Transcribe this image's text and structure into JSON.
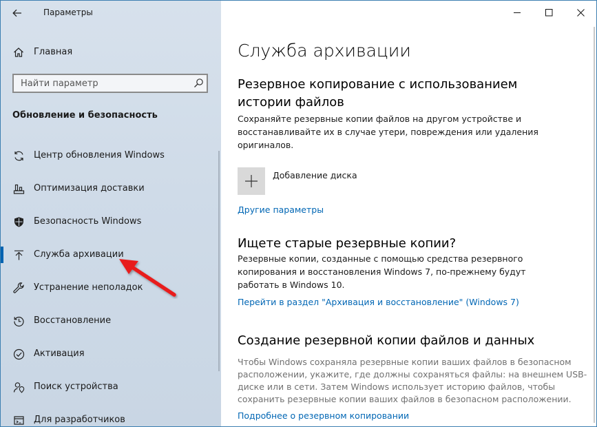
{
  "window": {
    "title": "Параметры",
    "controls": [
      "minimize-icon",
      "maximize-icon",
      "close-icon"
    ]
  },
  "sidebar": {
    "back_icon": "arrow-left-icon",
    "home": {
      "label": "Главная",
      "icon": "home-icon"
    },
    "search": {
      "placeholder": "Найти параметр",
      "value": "",
      "icon": "search-icon"
    },
    "section_title": "Обновление и безопасность",
    "selected_index": 3,
    "items": [
      {
        "label": "Центр обновления Windows",
        "icon": "sync-icon"
      },
      {
        "label": "Оптимизация доставки",
        "icon": "delivery-optimization-icon"
      },
      {
        "label": "Безопасность Windows",
        "icon": "shield-icon"
      },
      {
        "label": "Служба архивации",
        "icon": "upload-arrow-icon"
      },
      {
        "label": "Устранение неполадок",
        "icon": "wrench-icon"
      },
      {
        "label": "Восстановление",
        "icon": "history-icon"
      },
      {
        "label": "Активация",
        "icon": "check-circle-icon"
      },
      {
        "label": "Поиск устройства",
        "icon": "person-location-icon"
      },
      {
        "label": "Для разработчиков",
        "icon": "developer-icon"
      }
    ]
  },
  "main": {
    "title": "Служба архивации",
    "file_history": {
      "heading_line1": "Резервное копирование с использованием",
      "heading_line2": "истории файлов",
      "desc_line1": "Сохраняйте резервные копии файлов на другом устройстве и",
      "desc_line2": "восстанавливайте их в случае утери, повреждения или удаления",
      "desc_line3": "оригиналов.",
      "add_drive_label": "Добавление диска",
      "add_drive_icon": "plus-icon",
      "more_options": "Другие параметры"
    },
    "old_backup": {
      "heading": "Ищете старые резервные копии?",
      "desc_line1": "Резервные копии, созданные с помощью средства резервного",
      "desc_line2": "копирования и восстановления Windows 7, по-прежнему будут",
      "desc_line3": "работать в Windows 10.",
      "link": "Перейти в раздел \"Архивация и восстановление\" (Windows 7)"
    },
    "create_backup": {
      "heading": "Создание резервной копии файлов и данных",
      "desc_line1": "Чтобы Windows сохраняла резервные копии ваших файлов в безопасном",
      "desc_line2": "расположении, укажите, где должны сохраняться файлы: на внешнем USB-",
      "desc_line3": "диске или в сети. Затем Windows использует историю файлов, чтобы",
      "desc_line4": "сохранить резервные копии ваших файлов в безопасном расположении.",
      "link": "Подробнее о резервном копировании"
    }
  },
  "colors": {
    "sidebar_bg": "#cfdbe8",
    "accent": "#0063b1",
    "link": "#0066b4",
    "annotation_arrow": "#e81c1c"
  }
}
